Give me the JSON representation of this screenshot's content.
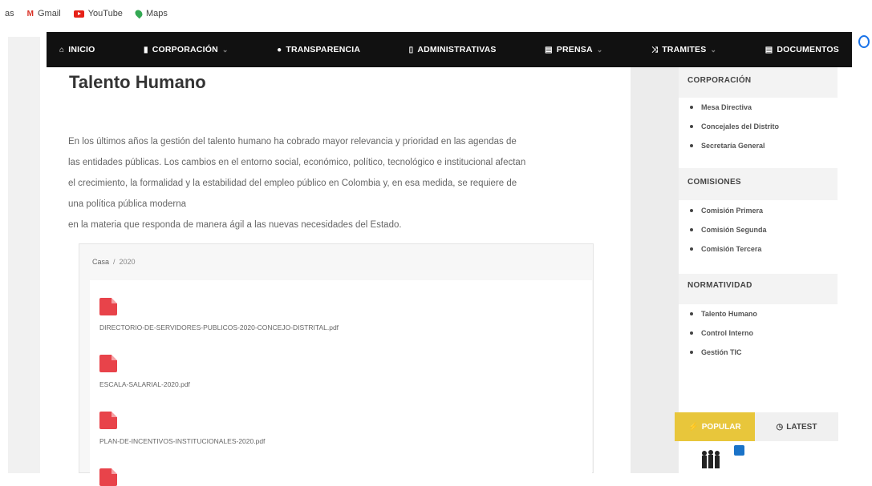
{
  "bookmarks": [
    {
      "label": "as",
      "icon": "partial-icon"
    },
    {
      "label": "Gmail",
      "icon": "gmail-icon"
    },
    {
      "label": "YouTube",
      "icon": "youtube-icon"
    },
    {
      "label": "Maps",
      "icon": "maps-icon"
    }
  ],
  "nav": {
    "items": [
      {
        "label": "INICIO",
        "icon": "home-icon",
        "caret": ""
      },
      {
        "label": "CORPORACIÓN",
        "icon": "building-icon",
        "caret": "⌄"
      },
      {
        "label": "TRANSPARENCIA",
        "icon": "info-icon",
        "caret": ""
      },
      {
        "label": "ADMINISTRATIVAS",
        "icon": "document-icon",
        "caret": ""
      },
      {
        "label": "PRENSA",
        "icon": "newspaper-icon",
        "caret": "⌄"
      },
      {
        "label": "TRAMITES",
        "icon": "shuffle-icon",
        "caret": "⌄"
      },
      {
        "label": "DOCUMENTOS",
        "icon": "folder-icon",
        "caret": ""
      }
    ]
  },
  "main": {
    "title": "Talento Humano",
    "intro_lines": [
      "En los últimos años la gestión del talento humano ha cobrado mayor relevancia y prioridad en las agendas de",
      "las entidades públicas. Los cambios en el entorno social, económico, político, tecnológico e institucional afectan",
      "el crecimiento, la formalidad y la estabilidad del empleo público en Colombia y, en esa medida, se requiere de",
      "una política pública moderna",
      "en la materia que responda de manera ágil a las nuevas necesidades del Estado."
    ],
    "breadcrumb": {
      "home": "Casa",
      "separator": "/",
      "current": "2020"
    },
    "documents": [
      {
        "name": "DIRECTORIO-DE-SERVIDORES-PUBLICOS-2020-CONCEJO-DISTRITAL.pdf",
        "icon": "pdf-file-icon"
      },
      {
        "name": "ESCALA-SALARIAL-2020.pdf",
        "icon": "pdf-file-icon"
      },
      {
        "name": "PLAN-DE-INCENTIVOS-INSTITUCIONALES-2020.pdf",
        "icon": "pdf-file-icon"
      }
    ]
  },
  "sidebar": {
    "widgets": [
      {
        "title": "CORPORACIÓN",
        "items": [
          "Mesa Directiva",
          "Concejales del Distrito",
          "Secretaría General"
        ]
      },
      {
        "title": "COMISIONES",
        "items": [
          "Comisión Primera",
          "Comisión Segunda",
          "Comisión Tercera"
        ]
      },
      {
        "title": "NORMATIVIDAD",
        "items": [
          "Talento Humano",
          "Control Interno",
          "Gestión TIC"
        ]
      }
    ],
    "tabs": {
      "popular": "POPULAR",
      "latest": "LATEST"
    },
    "colors": {
      "popular_tab": "#e8c63b",
      "nav_bg": "#111111",
      "pdf_icon": "#e8434a"
    }
  }
}
